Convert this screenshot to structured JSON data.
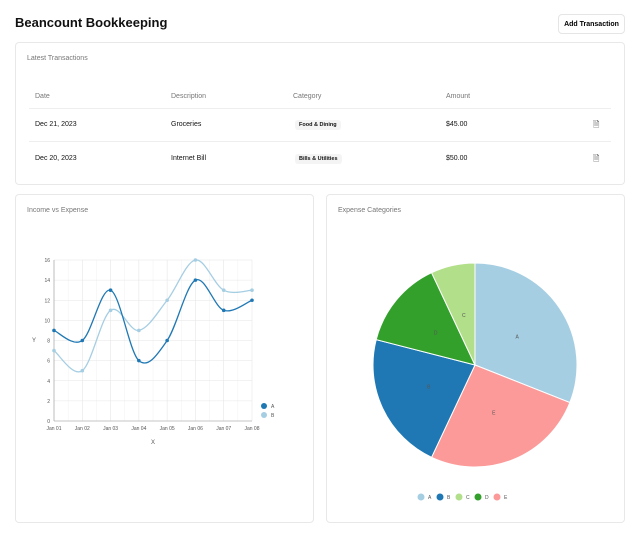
{
  "header": {
    "title": "Beancount Bookkeeping",
    "add_button": "Add Transaction"
  },
  "transactions": {
    "title": "Latest Transactions",
    "columns": [
      "Date",
      "Description",
      "Category",
      "Amount"
    ],
    "rows": [
      {
        "date": "Dec 21, 2023",
        "description": "Groceries",
        "category": "Food & Dining",
        "amount": "$45.00",
        "action_icon": "edit-document-icon"
      },
      {
        "date": "Dec 20, 2023",
        "description": "Internet Bill",
        "category": "Bills & Utilities",
        "amount": "$50.00",
        "action_icon": "edit-document-icon"
      }
    ]
  },
  "chart_data": [
    {
      "type": "line",
      "title": "Income vs Expense",
      "xlabel": "X",
      "ylabel": "Y",
      "categories": [
        "Jan 01",
        "Jan 02",
        "Jan 03",
        "Jan 04",
        "Jan 05",
        "Jan 06",
        "Jan 07",
        "Jan 08"
      ],
      "ylim": [
        0,
        16
      ],
      "yticks": [
        0,
        2,
        4,
        6,
        8,
        10,
        12,
        14,
        16
      ],
      "grid": true,
      "legend": "bottom-right",
      "series": [
        {
          "name": "A",
          "color": "#1f78b4",
          "values": [
            9,
            8,
            13,
            6,
            8,
            14,
            11,
            12
          ]
        },
        {
          "name": "B",
          "color": "#a6cee3",
          "values": [
            7,
            5,
            11,
            9,
            12,
            16,
            13,
            13
          ]
        }
      ]
    },
    {
      "type": "pie",
      "title": "Expense Categories",
      "legend": "bottom",
      "slices": [
        {
          "label": "A",
          "value": 31,
          "color": "#a6cee3"
        },
        {
          "label": "E",
          "value": 26,
          "color": "#fb9a99"
        },
        {
          "label": "B",
          "value": 22,
          "color": "#1f78b4"
        },
        {
          "label": "D",
          "value": 14,
          "color": "#33a02c"
        },
        {
          "label": "C",
          "value": 7,
          "color": "#b2df8a"
        }
      ],
      "legend_order": [
        "A",
        "B",
        "C",
        "D",
        "E"
      ]
    }
  ]
}
